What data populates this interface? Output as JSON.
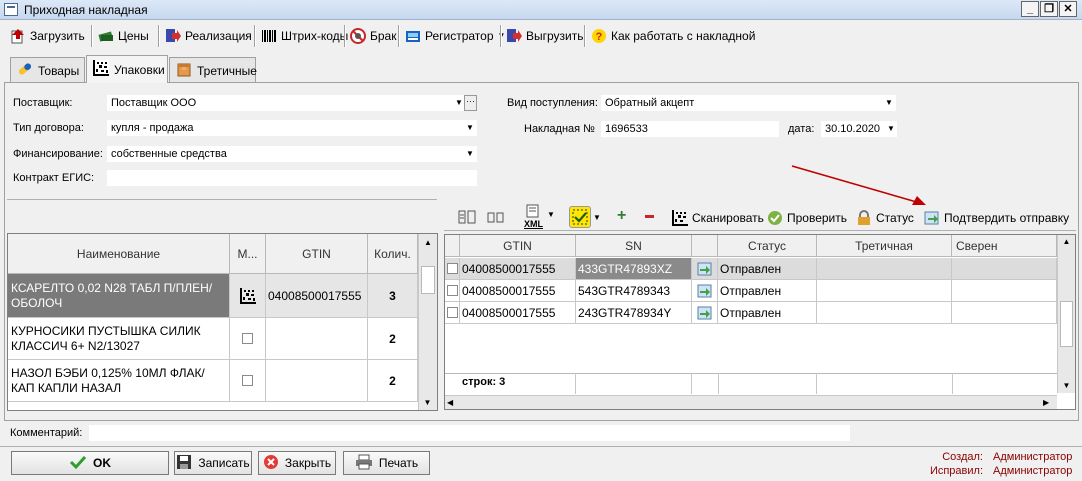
{
  "window": {
    "title": "Приходная накладная"
  },
  "toolbar": {
    "load": "Загрузить",
    "prices": "Цены",
    "sale": "Реализация",
    "barcodes": "Штрих-коды",
    "defect": "Брак",
    "registrar": "Регистратор",
    "export": "Выгрузить",
    "howto": "Как работать с накладной"
  },
  "tabs": [
    {
      "label": "Товары"
    },
    {
      "label": "Упаковки"
    },
    {
      "label": "Третичные"
    }
  ],
  "form": {
    "supplier_label": "Поставщик:",
    "supplier_value": "Поставщик ООО",
    "contract_type_label": "Тип договора:",
    "contract_type_value": "купля - продажа",
    "financing_label": "Финансирование:",
    "financing_value": "собственные средства",
    "egis_label": "Контракт ЕГИС:",
    "egis_value": "",
    "receipt_type_label": "Вид поступления:",
    "receipt_type_value": "Обратный акцепт",
    "invoice_label": "Накладная №",
    "invoice_value": "1696533",
    "date_label": "дата:",
    "date_value": "30.10.2020"
  },
  "left_table": {
    "headers": {
      "name": "Наименование",
      "m": "М...",
      "gtin": "GTIN",
      "qty": "Колич."
    },
    "rows": [
      {
        "name": "КСАРЕЛТО 0,02 N28 ТАБЛ П/ПЛЕН/ОБОЛОЧ",
        "gtin": "04008500017555",
        "qty": "3"
      },
      {
        "name": "КУРНОСИКИ ПУСТЫШКА СИЛИК КЛАССИЧ 6+ N2/13027",
        "gtin": "",
        "qty": "2"
      },
      {
        "name": "НАЗОЛ БЭБИ 0,125% 10МЛ ФЛАК/КАП КАПЛИ НАЗАЛ",
        "gtin": "",
        "qty": "2"
      }
    ]
  },
  "right_toolbar": {
    "scan": "Сканировать",
    "check": "Проверить",
    "status": "Статус",
    "confirm": "Подтвердить отправку",
    "xml": "XML"
  },
  "right_table": {
    "headers": {
      "gtin": "GTIN",
      "sn": "SN",
      "status": "Статус",
      "tertiary": "Третичная",
      "verified": "Сверен"
    },
    "rows": [
      {
        "gtin": "04008500017555",
        "sn": "433GTR47893XZ",
        "status": "Отправлен"
      },
      {
        "gtin": "04008500017555",
        "sn": "543GTR4789343",
        "status": "Отправлен"
      },
      {
        "gtin": "04008500017555",
        "sn": "243GTR478934Y",
        "status": "Отправлен"
      }
    ],
    "footer": "строк: 3"
  },
  "comment": {
    "label": "Комментарий:",
    "value": ""
  },
  "buttons": {
    "ok": "OK",
    "save": "Записать",
    "close": "Закрыть",
    "print": "Печать"
  },
  "audit": {
    "created_label": "Создал:",
    "created_value": "Администратор",
    "edited_label": "Исправил:",
    "edited_value": "Администратор"
  },
  "colors": {
    "arrow": "#c00000",
    "selected_row": "#7a7a7a"
  }
}
